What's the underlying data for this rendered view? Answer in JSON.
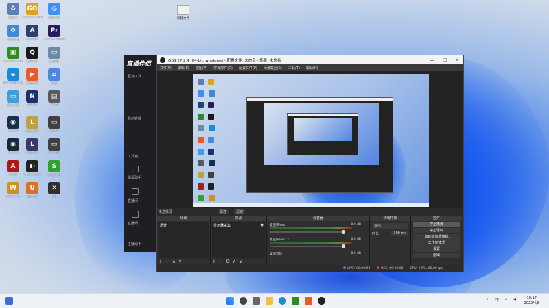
{
  "desktop_icons": [
    {
      "label": "回收站",
      "color": "#5b7fb8",
      "glyph": "♻"
    },
    {
      "label": "Counter-Strike Global Offensive",
      "color": "#e0a020",
      "glyph": "GO"
    },
    {
      "label": "百度网盘",
      "color": "#3e8ef7",
      "glyph": "◎"
    },
    {
      "label": "控制面板",
      "color": "#3f8ad8",
      "glyph": "⚙"
    },
    {
      "label": "Arctime",
      "color": "#2c3e6e",
      "glyph": "A"
    },
    {
      "label": "Adobe Premiere",
      "color": "#2a1a5e",
      "glyph": "Pr"
    },
    {
      "label": "GeForce Experience",
      "color": "#2f8a22",
      "glyph": "▣"
    },
    {
      "label": "腾讯QQ",
      "color": "#1a1a1a",
      "glyph": "Q"
    },
    {
      "label": "此电脑",
      "color": "#6d8aa8",
      "glyph": "▭"
    },
    {
      "label": "Microsoft Edge",
      "color": "#1b8bd6",
      "glyph": "e"
    },
    {
      "label": "傲软录屏",
      "color": "#e85a2a",
      "glyph": "▶"
    },
    {
      "label": "网络",
      "color": "#4a8ad8",
      "glyph": "⌂"
    },
    {
      "label": "显示桌面",
      "color": "#3ca0e0",
      "glyph": "▭"
    },
    {
      "label": "NVIDIA",
      "color": "#1a3070",
      "glyph": "N"
    },
    {
      "label": "GTA5",
      "color": "#5a5a5a",
      "glyph": "▤"
    },
    {
      "label": "Steam",
      "color": "#17304a",
      "glyph": "◉"
    },
    {
      "label": "英雄联盟",
      "color": "#c0a040",
      "glyph": "L"
    },
    {
      "label": "mayo",
      "color": "#404040",
      "glyph": "▭"
    },
    {
      "label": "Steam",
      "color": "#1b2838",
      "glyph": "◉"
    },
    {
      "label": "Logitech",
      "color": "#3a3a6a",
      "glyph": "L"
    },
    {
      "label": "mayo2",
      "color": "#404040",
      "glyph": "▭"
    },
    {
      "label": "APEX",
      "color": "#b01818",
      "glyph": "A"
    },
    {
      "label": "OBS Studio",
      "color": "#222222",
      "glyph": "◐"
    },
    {
      "label": "驱动人生",
      "color": "#30a030",
      "glyph": "S"
    },
    {
      "label": "WeGame",
      "color": "#d09020",
      "glyph": "W"
    },
    {
      "label": "网易UU",
      "color": "#e07020",
      "glyph": "U"
    },
    {
      "label": "MSI",
      "color": "#303030",
      "glyph": "✕"
    }
  ],
  "top_file_label": "新建文件",
  "bg_app": {
    "brand": "直播伴侣",
    "items": [
      "互动工具",
      "我的直播",
      "工具箱",
      "弹幕助手",
      "直播间",
      "直播间",
      "主播助手"
    ]
  },
  "obs": {
    "title": "OBS 27.2.4 (64-bit, windows) - 配置文件: 未命名 - 场景: 未命名",
    "menu": [
      "文件(F)",
      "编辑(E)",
      "视图(V)",
      "停靠部件(D)",
      "配置文件(P)",
      "场景集合(S)",
      "工具(T)",
      "帮助(H)"
    ],
    "no_source_label": "未选择源",
    "properties_btn": "属性",
    "filters_btn": "滤镜",
    "docks": {
      "scenes": {
        "title": "场景",
        "items": [
          "场景"
        ]
      },
      "sources": {
        "title": "来源",
        "items": [
          "显示器采集"
        ]
      },
      "mixer": {
        "title": "混音器",
        "channels": [
          {
            "name": "麦克风/Aux",
            "db": "0.0 dB"
          },
          {
            "name": "麦克风/Aux 2",
            "db": "0.0 dB"
          },
          {
            "name": "桌面音频",
            "db": "0.0 dB"
          }
        ]
      },
      "transitions": {
        "title": "转场特效",
        "type": "淡出",
        "duration_label": "时长",
        "duration": "300 ms"
      },
      "controls": {
        "title": "控件",
        "buttons": [
          "停止推流",
          "停止录制",
          "启动虚拟摄像机",
          "工作室模式",
          "设置",
          "退出"
        ]
      }
    },
    "status": {
      "live": "LIVE: 00:00:00",
      "rec": "REC: 00:00:00",
      "cpu": "CPU: 0.9%, 60.00 fps"
    }
  },
  "taskbar": {
    "clock_time": "18:17",
    "clock_date": "2022/4/8",
    "tray_lang": "中"
  }
}
